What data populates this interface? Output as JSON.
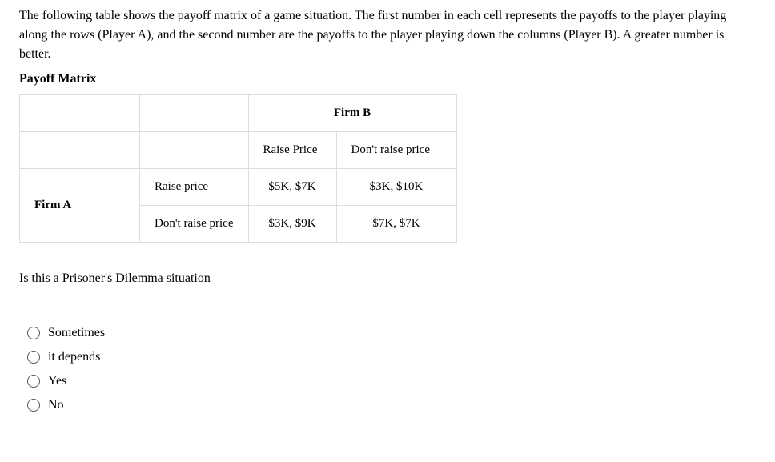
{
  "intro": "The following table shows the payoff matrix of a game situation. The first number in each cell represents the payoffs to the player playing along the rows (Player A), and the second number are the payoffs to the player playing down the columns (Player B). A greater number is better.",
  "matrix_title": "Payoff Matrix",
  "table": {
    "firm_b_header": "Firm B",
    "firm_a_header": "Firm A",
    "col_raise": "Raise Price",
    "col_dont": "Don't raise price",
    "row_raise_label": "Raise price",
    "row_dont_label": "Don't raise price",
    "cells": {
      "raise_raise": "$5K, $7K",
      "raise_dont": "$3K, $10K",
      "dont_raise": "$3K, $9K",
      "dont_dont": "$7K, $7K"
    }
  },
  "question": "Is this a Prisoner's Dilemma situation",
  "options": [
    "Sometimes",
    "it depends",
    "Yes",
    "No"
  ],
  "chart_data": {
    "type": "table",
    "title": "Payoff Matrix",
    "row_player": "Firm A",
    "column_player": "Firm B",
    "row_strategies": [
      "Raise price",
      "Don't raise price"
    ],
    "column_strategies": [
      "Raise Price",
      "Don't raise price"
    ],
    "payoffs": [
      [
        {
          "A": 5,
          "B": 7
        },
        {
          "A": 3,
          "B": 10
        }
      ],
      [
        {
          "A": 3,
          "B": 9
        },
        {
          "A": 7,
          "B": 7
        }
      ]
    ],
    "units": "$K"
  }
}
